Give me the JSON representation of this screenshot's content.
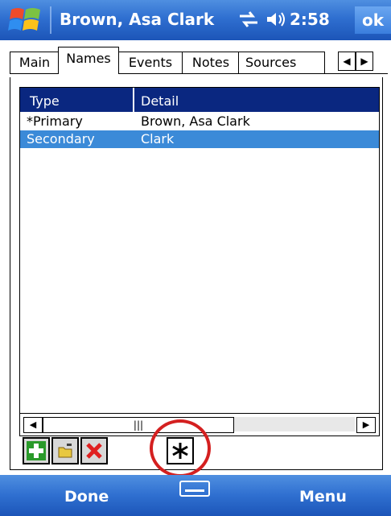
{
  "titlebar": {
    "title": "Brown, Asa Clark",
    "time": "2:58",
    "ok_label": "ok",
    "icons": [
      "windows-start-icon",
      "sync-icon",
      "speaker-icon"
    ]
  },
  "tabs": [
    {
      "label": "Main",
      "active": false
    },
    {
      "label": "Names",
      "active": true
    },
    {
      "label": "Events",
      "active": false
    },
    {
      "label": "Notes",
      "active": false
    },
    {
      "label": "Sources",
      "active": false
    }
  ],
  "tab_scroll": {
    "left_icon": "left-arrow-icon",
    "right_icon": "right-arrow-icon"
  },
  "list": {
    "columns": [
      "Type",
      "Detail"
    ],
    "rows": [
      {
        "type": "*Primary",
        "detail": "Brown, Asa Clark",
        "selected": false
      },
      {
        "type": "Secondary",
        "detail": "Clark",
        "selected": true
      }
    ]
  },
  "toolbar": {
    "buttons": [
      "add-icon",
      "edit-icon",
      "delete-icon",
      "set-primary-icon"
    ]
  },
  "commandbar": {
    "left_label": "Done",
    "right_label": "Menu"
  },
  "colors": {
    "titlebar": "#2f6fd0",
    "header": "#0a2780",
    "selection": "#3b8ad8",
    "highlight": "#d42020"
  }
}
